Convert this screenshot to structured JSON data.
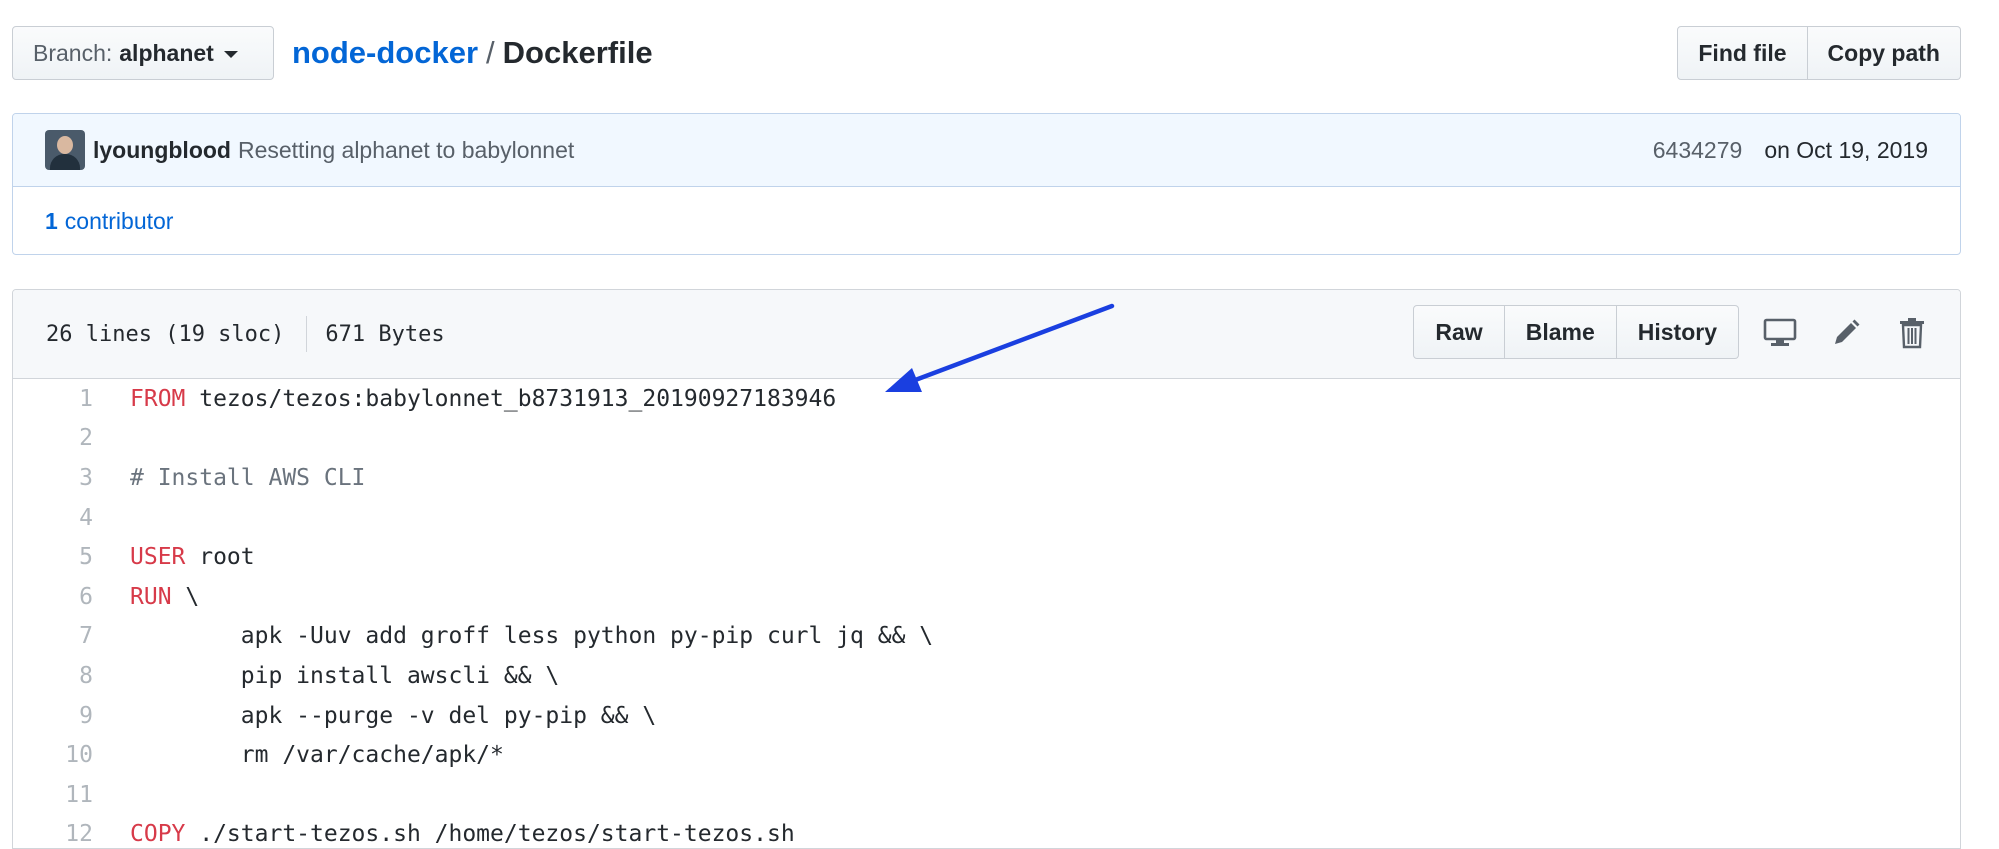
{
  "branch": {
    "label": "Branch:",
    "value": "alphanet"
  },
  "breadcrumb": {
    "repo": "node-docker",
    "separator": "/",
    "file": "Dockerfile"
  },
  "top_buttons": {
    "find_file": "Find file",
    "copy_path": "Copy path"
  },
  "commit": {
    "author": "lyoungblood",
    "message": "Resetting alphanet to babylonnet",
    "sha": "6434279",
    "date": "on Oct 19, 2019"
  },
  "contributors": {
    "count": "1",
    "label": "contributor"
  },
  "file": {
    "lines_info": "26 lines (19 sloc)",
    "size": "671 Bytes",
    "raw_label": "Raw",
    "blame_label": "Blame",
    "history_label": "History"
  },
  "code_lines": [
    {
      "n": "1",
      "kw": "FROM",
      "rest": " tezos/tezos:babylonnet_b8731913_20190927183946"
    },
    {
      "n": "2",
      "kw": "",
      "rest": ""
    },
    {
      "n": "3",
      "kw": "",
      "comment": "# Install AWS CLI",
      "rest": ""
    },
    {
      "n": "4",
      "kw": "",
      "rest": ""
    },
    {
      "n": "5",
      "kw": "USER",
      "rest": " root"
    },
    {
      "n": "6",
      "kw": "RUN",
      "rest": " \\"
    },
    {
      "n": "7",
      "kw": "",
      "rest": "        apk -Uuv add groff less python py-pip curl jq && \\"
    },
    {
      "n": "8",
      "kw": "",
      "rest": "        pip install awscli && \\"
    },
    {
      "n": "9",
      "kw": "",
      "rest": "        apk --purge -v del py-pip && \\"
    },
    {
      "n": "10",
      "kw": "",
      "rest": "        rm /var/cache/apk/*"
    },
    {
      "n": "11",
      "kw": "",
      "rest": ""
    },
    {
      "n": "12",
      "kw": "COPY",
      "rest": " ./start-tezos.sh /home/tezos/start-tezos.sh"
    }
  ],
  "colors": {
    "link": "#0366d6",
    "keyword": "#d73a49",
    "comment": "#6a737d",
    "annotation_arrow": "#1a3fe0"
  },
  "icons": [
    "monitor-icon",
    "pencil-icon",
    "trash-icon",
    "annotation-arrow"
  ]
}
